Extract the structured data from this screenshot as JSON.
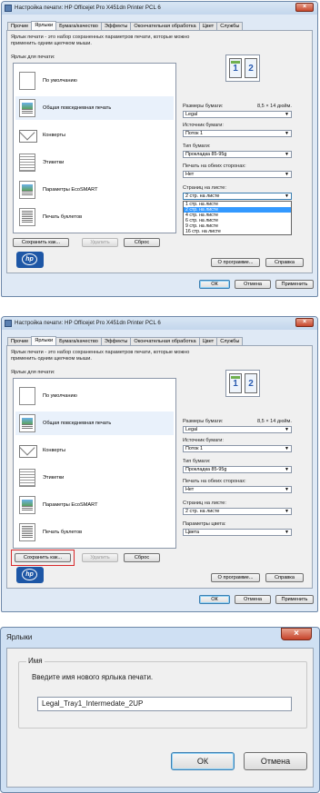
{
  "dialog": {
    "title": "Настройка печати: HP Officejet Pro X451dn Printer PCL 6",
    "tabs": [
      "Прочие",
      "Ярлыки",
      "Бумага/качество",
      "Эффекты",
      "Окончательная обработка",
      "Цвет",
      "Службы"
    ],
    "active_tab": "Ярлыки",
    "description": "Ярлык печати - это набор сохраненных параметров печати, которые можно применить одним щелчком мыши.",
    "shortcuts_label": "Ярлык для печати:",
    "shortcuts": [
      "По умолчанию",
      "Общая повседневная печать",
      "Конверты",
      "Этикетки",
      "Параметры EcoSMART",
      "Печать буклетов"
    ],
    "selected_shortcut": "Общая повседневная печать",
    "paper_size_label": "Размеры бумаги:",
    "paper_size_value": "8,5 × 14 дюйм.",
    "paper_size": "Legal",
    "paper_source_label": "Источник бумаги:",
    "paper_source": "Поток 1",
    "paper_type_label": "Тип бумаги:",
    "paper_type": "Прокладка 85-95g",
    "duplex_label": "Печать на обеих сторонах:",
    "duplex": "Нет",
    "pages_per_sheet_label": "Страниц на листе:",
    "pages_per_sheet": "2 стр. на листе",
    "pages_per_sheet_options": [
      "1 стр. на листе",
      "2 стр. на листе",
      "4 стр. на листе",
      "6 стр. на листе",
      "9 стр. на листе",
      "16 стр. на листе"
    ],
    "color_params_label": "Параметры цвета:",
    "color_params": "Цвета",
    "save_as_label": "Сохранить как...",
    "delete_label": "Удалить",
    "reset_label": "Сброс",
    "about_label": "О программе...",
    "help_label": "Справка",
    "ok_label": "ОК",
    "cancel_label": "Отмена",
    "apply_label": "Применить",
    "preview_pages": [
      "1",
      "2"
    ],
    "logo_text": "hp",
    "logo_tagline": "i n v e n t"
  },
  "name_dialog": {
    "title": "Ярлыки",
    "group_label": "Имя",
    "prompt": "Введите имя нового ярлыка печати.",
    "name_value": "Legal_Tray1_Intermedate_2UP",
    "ok_label": "ОК",
    "cancel_label": "Отмена"
  }
}
